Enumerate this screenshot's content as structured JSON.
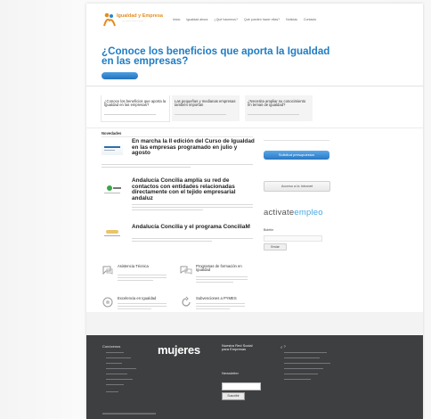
{
  "site": {
    "logo_main": "Igualdad y Empresa",
    "logo_sub": "·····················"
  },
  "nav": {
    "items": [
      "Inicio",
      "Igualdad ahora",
      "¿Qué hacemos?",
      "Qué pueden hacer ellas?",
      "Noticias",
      "Contacto"
    ]
  },
  "hero": {
    "title": "¿Conoce los beneficios que aporta la Igualdad en las empresas?"
  },
  "tabs": [
    {
      "label": "¿Conoce los beneficios que aporta la Igualdad en las empresas?"
    },
    {
      "label": "Las pequeñas y medianas empresas también importan"
    },
    {
      "label": "¿Necesita ampliar su conocimiento en temas de igualdad?"
    }
  ],
  "section": {
    "title": "Novedades"
  },
  "news": [
    {
      "title": "En marcha la II edición del Curso de Igualdad en las empresas programado en julio y agosto"
    },
    {
      "title": "Andalucía Concilia amplía su red de contactos con entidades relacionadas directamente con el tejido empresarial andaluz"
    },
    {
      "title": "Andalucía Concilia y el programa ConciliaM"
    }
  ],
  "features": [
    {
      "label": "Asistencia Técnica"
    },
    {
      "label": "Programas de formación en Igualdad"
    },
    {
      "label": "Excelencia en Igualdad"
    },
    {
      "label": "Subvenciones a PYMES"
    }
  ],
  "sidebar": {
    "blue_button": "Solicitud presupuestos",
    "gray_button": "Acceso a la Intranet",
    "activate_a": "activate",
    "activate_b": "empleo",
    "field_label": "Boletín",
    "small_button": "Enviar"
  },
  "footer": {
    "col1_title": "Conócenos",
    "logo": "mujeres",
    "social": "Nuestra Red Social para Empresas",
    "newsletter": "Newsletter",
    "newsletter_button": "Suscribir",
    "col4_title": "¿ ?"
  },
  "colors": {
    "brand_blue": "#1e7cc4",
    "logo_orange": "#e58c1c",
    "footer_bg": "#3d3f41"
  }
}
